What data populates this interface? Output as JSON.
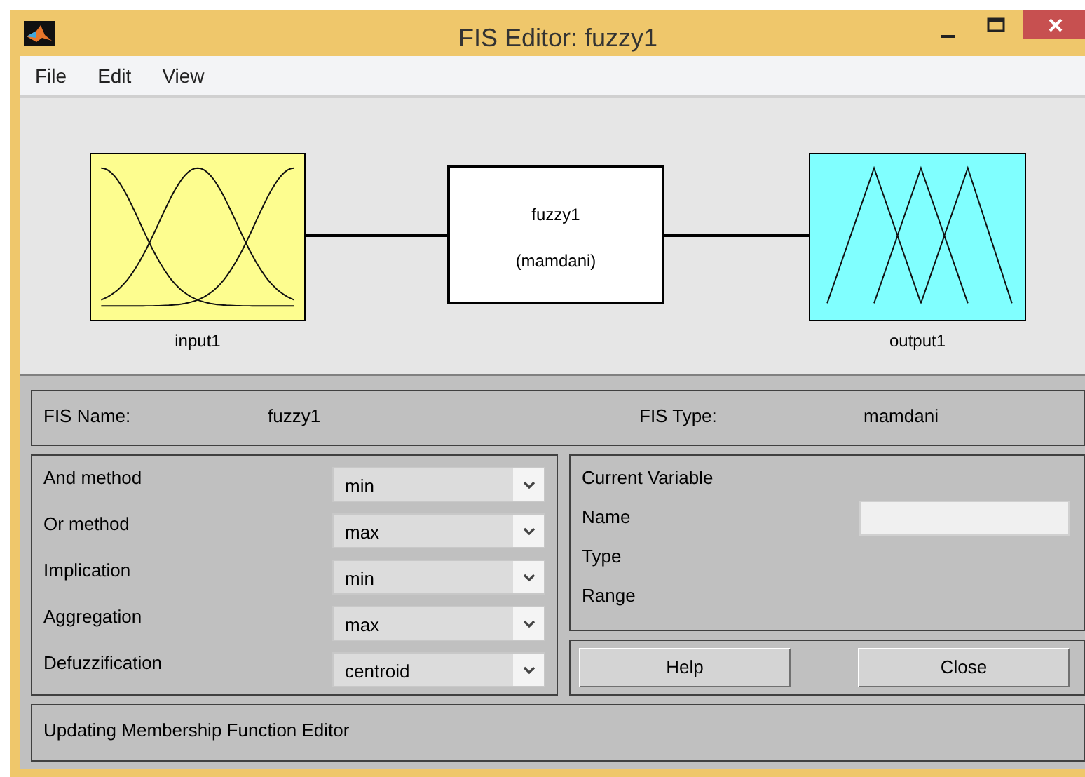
{
  "window": {
    "title": "FIS Editor: fuzzy1"
  },
  "menu": [
    "File",
    "Edit",
    "View"
  ],
  "diagram": {
    "input": {
      "label": "input1"
    },
    "system": {
      "name": "fuzzy1",
      "type": "(mamdani)"
    },
    "output": {
      "label": "output1"
    }
  },
  "fis": {
    "name_label": "FIS Name:",
    "name": "fuzzy1",
    "type_label": "FIS Type:",
    "type": "mamdani"
  },
  "methods": [
    {
      "label": "And method",
      "value": "min"
    },
    {
      "label": "Or method",
      "value": "max"
    },
    {
      "label": "Implication",
      "value": "min"
    },
    {
      "label": "Aggregation",
      "value": "max"
    },
    {
      "label": "Defuzzification",
      "value": "centroid"
    }
  ],
  "current_variable": {
    "title": "Current Variable",
    "fields": [
      {
        "label": "Name",
        "kind": "input"
      },
      {
        "label": "Type",
        "kind": "text"
      },
      {
        "label": "Range",
        "kind": "text"
      }
    ]
  },
  "buttons": [
    "Help",
    "Close"
  ],
  "status": "Updating Membership Function Editor"
}
